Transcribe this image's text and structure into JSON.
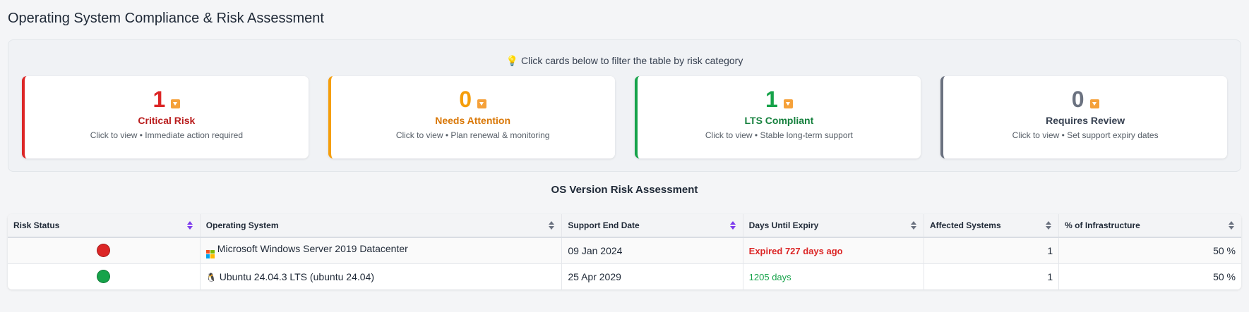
{
  "page_title": "Operating System Compliance & Risk Assessment",
  "hint": {
    "icon": "lightbulb-icon",
    "glyph": "💡",
    "text": "Click cards below to filter the table by risk category"
  },
  "cards": [
    {
      "count": "1",
      "label": "Critical Risk",
      "sub": "Click to view • Immediate action required",
      "color": "#dc2626"
    },
    {
      "count": "0",
      "label": "Needs Attention",
      "sub": "Click to view • Plan renewal & monitoring",
      "color": "#f59e0b"
    },
    {
      "count": "1",
      "label": "LTS Compliant",
      "sub": "Click to view • Stable long-term support",
      "color": "#16a34a"
    },
    {
      "count": "0",
      "label": "Requires Review",
      "sub": "Click to view • Set support expiry dates",
      "color": "#6b7280"
    }
  ],
  "table": {
    "title": "OS Version Risk Assessment",
    "headers": [
      "Risk Status",
      "Operating System",
      "Support End Date",
      "Days Until Expiry",
      "Affected Systems",
      "% of Infrastructure"
    ],
    "sort_active_columns": [
      0,
      2
    ],
    "rows": [
      {
        "status_color": "#dc2626",
        "os_icon": "windows-icon",
        "os": "Microsoft Windows Server 2019 Datacenter",
        "end_date": "09 Jan 2024",
        "days": "Expired 727 days ago",
        "affected": "1",
        "percent": "50 %"
      },
      {
        "status_color": "#16a34a",
        "os_icon": "linux-tux-icon",
        "os_glyph": "🐧",
        "os": "Ubuntu 24.04.3 LTS (ubuntu 24.04)",
        "end_date": "25 Apr 2029",
        "days": "1205 days",
        "affected": "1",
        "percent": "50 %"
      }
    ]
  }
}
